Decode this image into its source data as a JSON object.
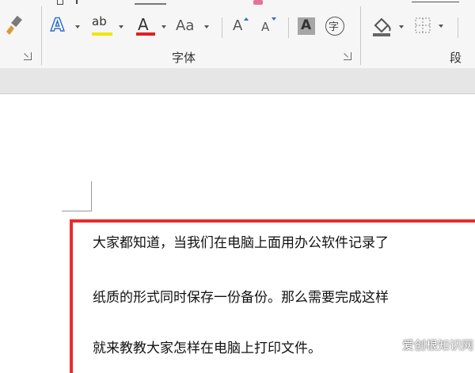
{
  "ribbon": {
    "font_group_label": "字体",
    "paragraph_group_label": "段",
    "text_effects_glyph": "A",
    "highlight_glyph": "ab",
    "font_color_glyph": "A",
    "change_case_label": "Aa",
    "grow_font_glyph": "A",
    "shrink_font_glyph": "A",
    "char_shading_glyph": "A",
    "enclose_char_glyph": "字",
    "icons": [
      "format-painter-icon",
      "text-effects-icon",
      "text-highlight-color-icon",
      "font-color-icon",
      "change-case-icon",
      "grow-font-icon",
      "shrink-font-icon",
      "character-shading-icon",
      "enclose-characters-icon",
      "shading-icon",
      "borders-icon",
      "dialog-launcher-icon"
    ],
    "colors": {
      "highlight_bar": "#f0e600",
      "font_color_bar": "#e02020",
      "text_effects": "#2e6fd1"
    }
  },
  "document": {
    "lines": [
      "大家都知道，当我们在电脑上面用办公软件记录了",
      "纸质的形式同时保存一份备份。那么需要完成这样",
      "就来教教大家怎样在电脑上打印文件。"
    ],
    "selection_color": "#ea2b2b"
  },
  "watermark": "爱创根知识网"
}
